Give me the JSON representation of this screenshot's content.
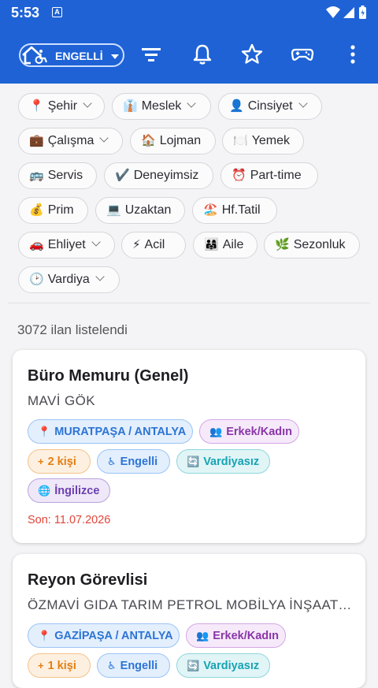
{
  "status_bar": {
    "time": "5:53",
    "notif_icon": "A"
  },
  "app_bar": {
    "filter_pill_label": "ENGELLİ",
    "actions": [
      "filter-icon",
      "bell-icon",
      "star-icon",
      "gamepad-icon",
      "more-vert-icon"
    ],
    "accent_color": "#1e62d6"
  },
  "filters": [
    {
      "emoji": "📍",
      "label": "Şehir",
      "dropdown": true
    },
    {
      "emoji": "👔",
      "label": "Meslek",
      "dropdown": true
    },
    {
      "emoji": "👤",
      "label": "Cinsiyet",
      "dropdown": true
    },
    {
      "emoji": "💼",
      "label": "Çalışma",
      "dropdown": true
    },
    {
      "emoji": "🏠",
      "label": "Lojman",
      "dropdown": false
    },
    {
      "emoji": "🍽️",
      "label": "Yemek",
      "dropdown": false
    },
    {
      "emoji": "🚌",
      "label": "Servis",
      "dropdown": false
    },
    {
      "emoji": "✔️",
      "label": "Deneyimsiz",
      "dropdown": false
    },
    {
      "emoji": "⏰",
      "label": "Part-time",
      "dropdown": false
    },
    {
      "emoji": "💰",
      "label": "Prim",
      "dropdown": false
    },
    {
      "emoji": "💻",
      "label": "Uzaktan",
      "dropdown": false
    },
    {
      "emoji": "🏖️",
      "label": "Hf.Tatil",
      "dropdown": false
    },
    {
      "emoji": "🚗",
      "label": "Ehliyet",
      "dropdown": true
    },
    {
      "emoji": "⚡",
      "label": "Acil",
      "dropdown": false
    },
    {
      "emoji": "👨‍👩‍👧",
      "label": "Aile",
      "dropdown": false
    },
    {
      "emoji": "🌿",
      "label": "Sezonluk",
      "dropdown": false
    },
    {
      "emoji": "🕑",
      "label": "Vardiya",
      "dropdown": true
    }
  ],
  "result_count": "3072 ilan listelendi",
  "listings": [
    {
      "title": "Büro Memuru (Genel)",
      "company": "MAVİ GÖK",
      "location": "MURATPAŞA / ANTALYA",
      "gender": "Erkek/Kadın",
      "count": "2 kişi",
      "disability": "Engelli",
      "shift": "Vardiyasız",
      "language": "İngilizce",
      "deadline": "Son: 11.07.2026"
    },
    {
      "title": "Reyon Görevlisi",
      "company": "ÖZMAVİ GIDA TARIM PETROL MOBİLYA İNŞAAT TURİZM",
      "location": "GAZİPAŞA / ANTALYA",
      "gender": "Erkek/Kadın",
      "count": "1 kişi",
      "disability": "Engelli",
      "shift": "Vardiyasız"
    }
  ]
}
